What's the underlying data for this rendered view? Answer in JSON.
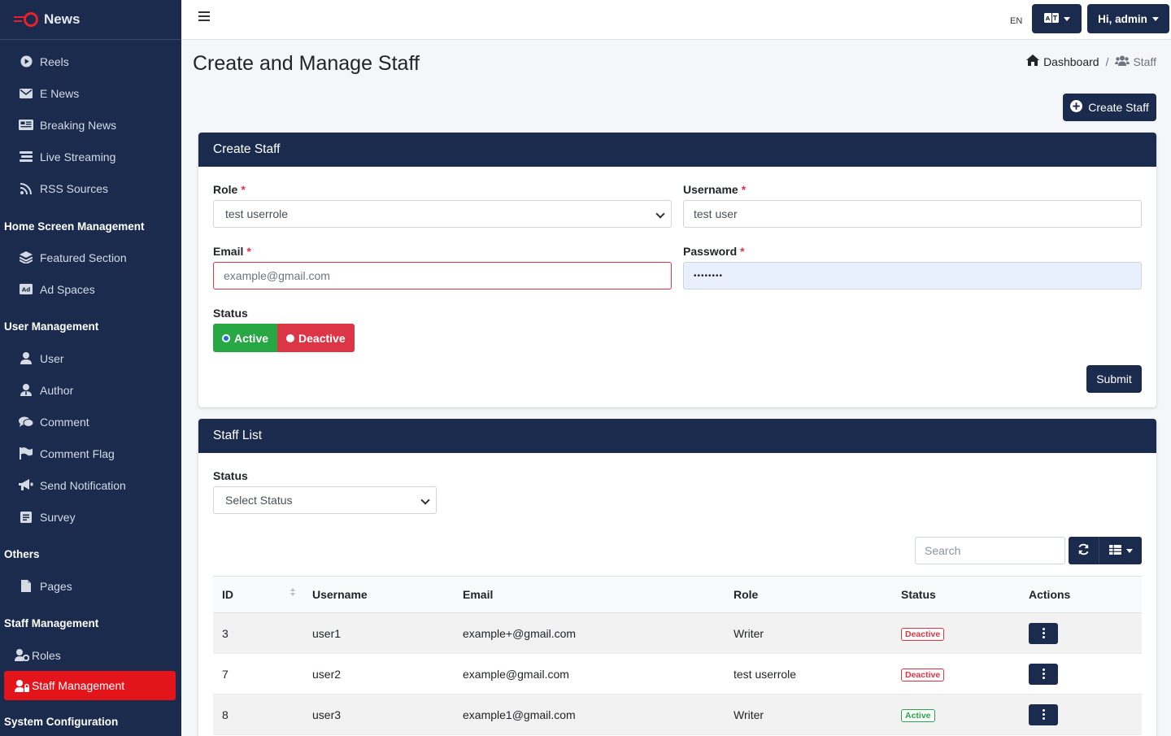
{
  "sidebar": {
    "brand": "News",
    "items": [
      {
        "label": "Reels",
        "icon": "play-circle-icon"
      },
      {
        "label": "E News",
        "icon": "envelope-icon"
      },
      {
        "label": "Breaking News",
        "icon": "newspaper-icon"
      },
      {
        "label": "Live Streaming",
        "icon": "stream-icon"
      },
      {
        "label": "RSS Sources",
        "icon": "rss-icon"
      }
    ],
    "sections": {
      "home_screen": "Home Screen Management",
      "user_mgmt": "User Management",
      "others": "Others",
      "staff_mgmt": "Staff Management",
      "system_config": "System Configuration"
    },
    "home_items": [
      {
        "label": "Featured Section",
        "icon": "layers-icon"
      },
      {
        "label": "Ad Spaces",
        "icon": "ad-icon"
      }
    ],
    "user_items": [
      {
        "label": "User",
        "icon": "user-icon"
      },
      {
        "label": "Author",
        "icon": "author-icon"
      },
      {
        "label": "Comment",
        "icon": "comments-icon"
      },
      {
        "label": "Comment Flag",
        "icon": "flag-icon"
      },
      {
        "label": "Send Notification",
        "icon": "bullhorn-icon"
      },
      {
        "label": "Survey",
        "icon": "survey-icon"
      }
    ],
    "other_items": [
      {
        "label": "Pages",
        "icon": "file-icon"
      }
    ],
    "staff_items": [
      {
        "label": "Roles",
        "icon": "user-cog-icon"
      },
      {
        "label": "Staff Management",
        "icon": "user-lock-icon",
        "active": true
      }
    ]
  },
  "topbar": {
    "lang": "EN",
    "user_greeting": "Hi, admin"
  },
  "page": {
    "title": "Create and Manage Staff",
    "breadcrumb": [
      "Dashboard",
      "/",
      "Staff"
    ],
    "create_button": "Create Staff"
  },
  "create_card": {
    "header": "Create Staff",
    "role_label": "Role",
    "role_value": "test userrole",
    "username_label": "Username",
    "username_value": "test user",
    "email_label": "Email",
    "email_placeholder": "example@gmail.com",
    "password_label": "Password",
    "password_value": "••••••••",
    "status_label": "Status",
    "status_active": "Active",
    "status_deactive": "Deactive",
    "submit": "Submit"
  },
  "list_card": {
    "header": "Staff List",
    "filter_label": "Status",
    "filter_value": "Select Status",
    "search_placeholder": "Search",
    "columns": [
      "ID",
      "Username",
      "Email",
      "Role",
      "Status",
      "Actions"
    ],
    "rows": [
      {
        "id": "3",
        "username": "user1",
        "email": "example+@gmail.com",
        "role": "Writer",
        "status": "Deactive"
      },
      {
        "id": "7",
        "username": "user2",
        "email": "example@gmail.com",
        "role": "test userrole",
        "status": "Deactive"
      },
      {
        "id": "8",
        "username": "user3",
        "email": "example1@gmail.com",
        "role": "Writer",
        "status": "Active"
      }
    ]
  },
  "colors": {
    "navy": "#1b2b4d",
    "danger": "#dc3545",
    "success": "#28a745",
    "active_nav": "#e4141b"
  }
}
